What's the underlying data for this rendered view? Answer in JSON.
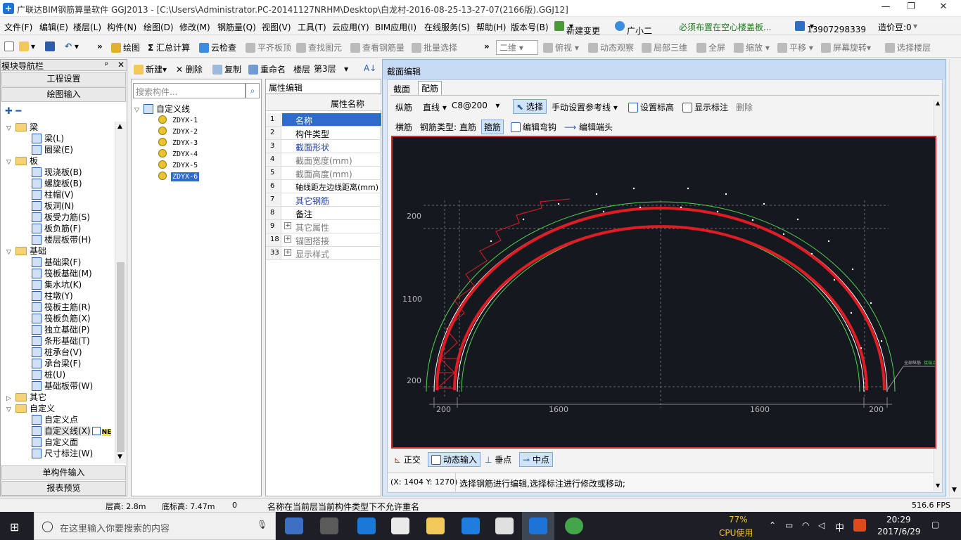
{
  "window": {
    "title": "广联达BIM钢筋算量软件 GGJ2013 - [C:\\Users\\Administrator.PC-20141127NRHM\\Desktop\\白龙村-2016-08-25-13-27-07(2166版).GGJ12]",
    "minimize": "—",
    "maximize": "❐",
    "close": "✕"
  },
  "menu": [
    "文件(F)",
    "编辑(E)",
    "楼层(L)",
    "构件(N)",
    "绘图(D)",
    "修改(M)",
    "钢筋量(Q)",
    "视图(V)",
    "工具(T)",
    "云应用(Y)",
    "BIM应用(I)",
    "在线服务(S)",
    "帮助(H)",
    "版本号(B)",
    "新建变更",
    "广小二",
    "必须布置在空心楼盖板...",
    "13907298339",
    "造价豆:0"
  ],
  "toolbar": {
    "draw": "绘图",
    "summary": "汇总计算",
    "cloud_check": "云检查",
    "align_top": "平齐板顶",
    "find": "查找图元",
    "view_rebar": "查看钢筋量",
    "batch_select": "批量选择",
    "view_mode": "二维",
    "top_view": "俯视",
    "dynamic_observe": "动态观察",
    "local_3d": "局部三维",
    "fullscreen": "全屏",
    "zoom": "缩放",
    "pan": "平移",
    "rotate": "屏幕旋转",
    "select_floor": "选择楼层"
  },
  "nav": {
    "header": "模块导航栏",
    "pin": "ᵖ",
    "close": "✕",
    "project_settings": "工程设置",
    "draw_input": "绘图输入",
    "tree": [
      {
        "label": "梁",
        "type": "folder"
      },
      {
        "label": "梁(L)",
        "type": "item"
      },
      {
        "label": "圈梁(E)",
        "type": "item"
      },
      {
        "label": "板",
        "type": "folder"
      },
      {
        "label": "现浇板(B)",
        "type": "item"
      },
      {
        "label": "螺旋板(B)",
        "type": "item"
      },
      {
        "label": "柱帽(V)",
        "type": "item"
      },
      {
        "label": "板洞(N)",
        "type": "item"
      },
      {
        "label": "板受力筋(S)",
        "type": "item"
      },
      {
        "label": "板负筋(F)",
        "type": "item"
      },
      {
        "label": "楼层板带(H)",
        "type": "item"
      },
      {
        "label": "基础",
        "type": "folder"
      },
      {
        "label": "基础梁(F)",
        "type": "item"
      },
      {
        "label": "筏板基础(M)",
        "type": "item"
      },
      {
        "label": "集水坑(K)",
        "type": "item"
      },
      {
        "label": "柱墩(Y)",
        "type": "item"
      },
      {
        "label": "筏板主筋(R)",
        "type": "item"
      },
      {
        "label": "筏板负筋(X)",
        "type": "item"
      },
      {
        "label": "独立基础(P)",
        "type": "item"
      },
      {
        "label": "条形基础(T)",
        "type": "item"
      },
      {
        "label": "桩承台(V)",
        "type": "item"
      },
      {
        "label": "承台梁(F)",
        "type": "item"
      },
      {
        "label": "桩(U)",
        "type": "item"
      },
      {
        "label": "基础板带(W)",
        "type": "item"
      },
      {
        "label": "其它",
        "type": "folder"
      },
      {
        "label": "自定义",
        "type": "folder"
      },
      {
        "label": "自定义点",
        "type": "item"
      },
      {
        "label": "自定义线(X)",
        "type": "item"
      },
      {
        "label": "自定义面",
        "type": "item"
      },
      {
        "label": "尺寸标注(W)",
        "type": "item"
      }
    ],
    "new_badge": "NE",
    "single_input": "单构件输入",
    "report": "报表预览"
  },
  "components": {
    "toolbar": {
      "new": "新建",
      "delete": "删除",
      "copy": "复制",
      "rename": "重命名",
      "floor_label": "楼层",
      "floor_value": "第3层"
    },
    "search_placeholder": "搜索构件...",
    "root": "自定义线",
    "items": [
      "ZDYX-1",
      "ZDYX-2",
      "ZDYX-3",
      "ZDYX-4",
      "ZDYX-5",
      "ZDYX-6"
    ]
  },
  "properties": {
    "tab": "属性编辑",
    "header": "属性名称",
    "rows": [
      {
        "num": "1",
        "name": "名称",
        "style": "selected"
      },
      {
        "num": "2",
        "name": "构件类型",
        "style": "normal"
      },
      {
        "num": "3",
        "name": "截面形状",
        "style": "blue"
      },
      {
        "num": "4",
        "name": "截面宽度(mm)",
        "style": "gray"
      },
      {
        "num": "5",
        "name": "截面高度(mm)",
        "style": "gray"
      },
      {
        "num": "6",
        "name": "轴线距左边线距离(mm)",
        "style": "normal"
      },
      {
        "num": "7",
        "name": "其它钢筋",
        "style": "blue"
      },
      {
        "num": "8",
        "name": "备注",
        "style": "normal"
      },
      {
        "num": "9",
        "name": "其它属性",
        "style": "gray",
        "expand": "+"
      },
      {
        "num": "18",
        "name": "锚固搭接",
        "style": "gray",
        "expand": "+"
      },
      {
        "num": "33",
        "name": "显示样式",
        "style": "gray",
        "expand": "+"
      }
    ]
  },
  "section_editor": {
    "title": "截面编辑",
    "tabs": [
      "截面",
      "配筋"
    ],
    "row1": {
      "longitudinal": "纵筋",
      "line_type": "直线",
      "spec": "C8@200",
      "select": "选择",
      "manual_ref": "手动设置参考线",
      "set_elevation": "设置标高",
      "show_dimension": "显示标注",
      "delete": "删除"
    },
    "row2": {
      "transverse": "横筋",
      "type_label": "钢筋类型:",
      "straight": "直筋",
      "stirrup": "箍筋",
      "edit_bend": "编辑弯钩",
      "edit_end": "编辑端头"
    },
    "dims": {
      "top": "200",
      "left_mid": "1100",
      "left_bottom": "200",
      "bottom": [
        "200",
        "1600",
        "1600",
        "200"
      ]
    },
    "callout": "全部纵筋",
    "callout2": "接端点",
    "snap": {
      "orthogonal": "正交",
      "dynamic_input": "动态输入",
      "perpendicular": "垂点",
      "midpoint": "中点"
    },
    "coords": "(X: 1404 Y: 1270)",
    "hint": "选择钢筋进行编辑,选择标注进行修改或移动;"
  },
  "status": {
    "floor_height": "层高: 2.8m",
    "base_height": "底标高: 7.47m",
    "zero": "0",
    "message": "名称在当前层当前构件类型下不允许重名",
    "fps": "516.6 FPS"
  },
  "taskbar": {
    "search": "在这里输入你要搜索的内容",
    "cpu": "77%",
    "cpu_label": "CPU使用",
    "ime": "中",
    "time": "20:29",
    "date": "2017/6/29"
  }
}
